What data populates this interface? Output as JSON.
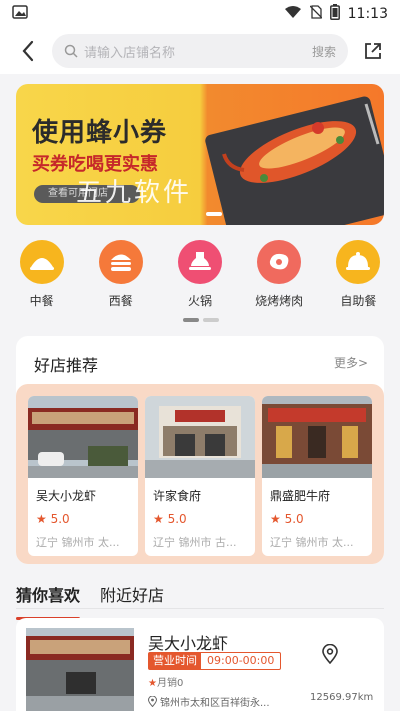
{
  "status_bar": {
    "time": "11:13",
    "icons": [
      "image-icon",
      "wifi-icon",
      "no-sim-icon",
      "battery-icon"
    ]
  },
  "header": {
    "search_placeholder": "请输入店铺名称",
    "search_button": "搜索"
  },
  "banner": {
    "title": "使用蜂小券",
    "subtitle": "买券吃喝更实惠",
    "cta": "查看可用门店",
    "watermark": "五九软件"
  },
  "categories": [
    {
      "label": "中餐",
      "color": "#f7b51e",
      "icon": "dumpling-icon"
    },
    {
      "label": "西餐",
      "color": "#f5793a",
      "icon": "burger-icon"
    },
    {
      "label": "火锅",
      "color": "#ef4f73",
      "icon": "hotpot-icon"
    },
    {
      "label": "烧烤烤肉",
      "color": "#f06a5e",
      "icon": "steak-icon"
    },
    {
      "label": "自助餐",
      "color": "#f7b51e",
      "icon": "buffet-icon"
    }
  ],
  "recommend": {
    "title": "好店推荐",
    "more": "更多>",
    "shops": [
      {
        "name": "吴大小龙虾",
        "rating": "5.0",
        "address": "辽宁 锦州市 太..."
      },
      {
        "name": "许家食府",
        "rating": "5.0",
        "address": "辽宁 锦州市 古..."
      },
      {
        "name": "鼎盛肥牛府",
        "rating": "5.0",
        "address": "辽宁 锦州市 太..."
      }
    ]
  },
  "tabs": [
    {
      "label": "猜你喜欢",
      "active": true
    },
    {
      "label": "附近好店",
      "active": false
    }
  ],
  "feed": [
    {
      "name": "吴大小龙虾",
      "status_label": "营业时间",
      "hours": "09:00-00:00",
      "sold": "月销0",
      "address": "锦州市太和区百祥街永...",
      "distance": "12569.97km"
    }
  ],
  "colors": {
    "accent": "#e4572e",
    "banner_yellow": "#f8d64a",
    "banner_orange": "#f5782a"
  }
}
